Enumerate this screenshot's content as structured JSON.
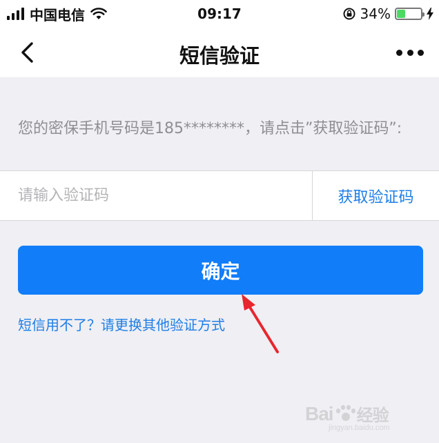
{
  "status_bar": {
    "carrier": "中国电信",
    "time": "09:17",
    "battery_percent": "34%",
    "battery_level": 0.34
  },
  "nav": {
    "title": "短信验证",
    "back_icon": "chevron-left-icon",
    "more_icon": "more-dots-icon"
  },
  "hint": {
    "text": "您的密保手机号码是185********，请点击”获取验证码”:"
  },
  "code_form": {
    "input_value": "",
    "input_placeholder": "请输入验证码",
    "get_code_label": "获取验证码"
  },
  "confirm_label": "确定",
  "alt_method_label": "短信用不了？请更换其他验证方式",
  "watermark": {
    "text": "Bai经验",
    "site": "jingyan.baidu.com"
  },
  "colors": {
    "accent": "#117df9",
    "link": "#1e7ee6",
    "background": "#efeff4",
    "annotation": "#e8262d"
  }
}
